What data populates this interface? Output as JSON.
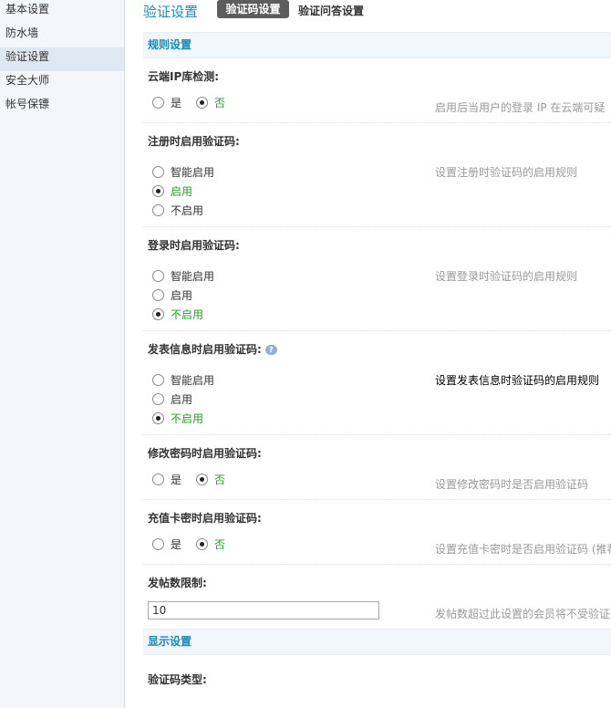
{
  "sidebar": {
    "items": [
      {
        "label": "基本设置"
      },
      {
        "label": "防水墙"
      },
      {
        "label": "验证设置"
      },
      {
        "label": "安全大师"
      },
      {
        "label": "帐号保镖"
      }
    ]
  },
  "header": {
    "title": "验证设置",
    "tabs": [
      {
        "label": "验证码设置"
      },
      {
        "label": "验证问答设置"
      }
    ]
  },
  "sections": {
    "rules": "规则设置",
    "display": "显示设置"
  },
  "settings": {
    "cloud_ip": {
      "label": "云端IP库检测:",
      "options": [
        "是",
        "否"
      ],
      "selected": "否",
      "hint": "启用后当用户的登录 IP 在云端可疑"
    },
    "register": {
      "label": "注册时启用验证码:",
      "options": [
        "智能启用",
        "启用",
        "不启用"
      ],
      "selected": "启用",
      "hint": "设置注册时验证码的启用规则"
    },
    "login": {
      "label": "登录时启用验证码:",
      "options": [
        "智能启用",
        "启用",
        "不启用"
      ],
      "selected": "不启用",
      "hint": "设置登录时验证码的启用规则"
    },
    "post": {
      "label": "发表信息时启用验证码:",
      "options": [
        "智能启用",
        "启用",
        "不启用"
      ],
      "selected": "不启用",
      "hint": "设置发表信息时验证码的启用规则"
    },
    "change_password": {
      "label": "修改密码时启用验证码:",
      "options": [
        "是",
        "否"
      ],
      "selected": "否",
      "hint": "设置修改密码时是否启用验证码"
    },
    "recharge": {
      "label": "充值卡密时启用验证码:",
      "options": [
        "是",
        "否"
      ],
      "selected": "否",
      "hint": "设置充值卡密时是否启用验证码 (推荐"
    },
    "post_limit": {
      "label": "发帖数限制:",
      "value": "10",
      "hint": "发帖数超过此设置的会员将不受验证"
    },
    "captcha_type": {
      "label": "验证码类型:"
    }
  }
}
